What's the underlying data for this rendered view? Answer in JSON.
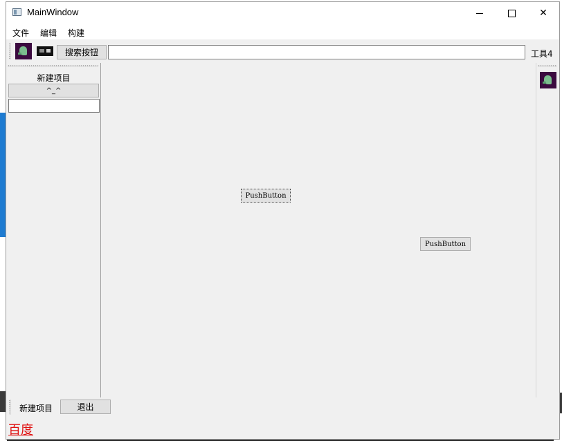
{
  "window": {
    "title": "MainWindow"
  },
  "menu": {
    "items": [
      "文件",
      "编辑",
      "构建"
    ]
  },
  "toolbar": {
    "search_button": "搜索按钮",
    "search_value": "",
    "tool4_label": "工具4"
  },
  "dock_left": {
    "title": "新建项目",
    "button_label": "^_^",
    "input_value": ""
  },
  "central": {
    "button1": "PushButton",
    "button2": "PushButton"
  },
  "bottom_toolbar": {
    "new_item": "新建项目",
    "exit_button": "退出"
  },
  "status": {
    "link": "百度",
    "link_color": "#e01010"
  }
}
